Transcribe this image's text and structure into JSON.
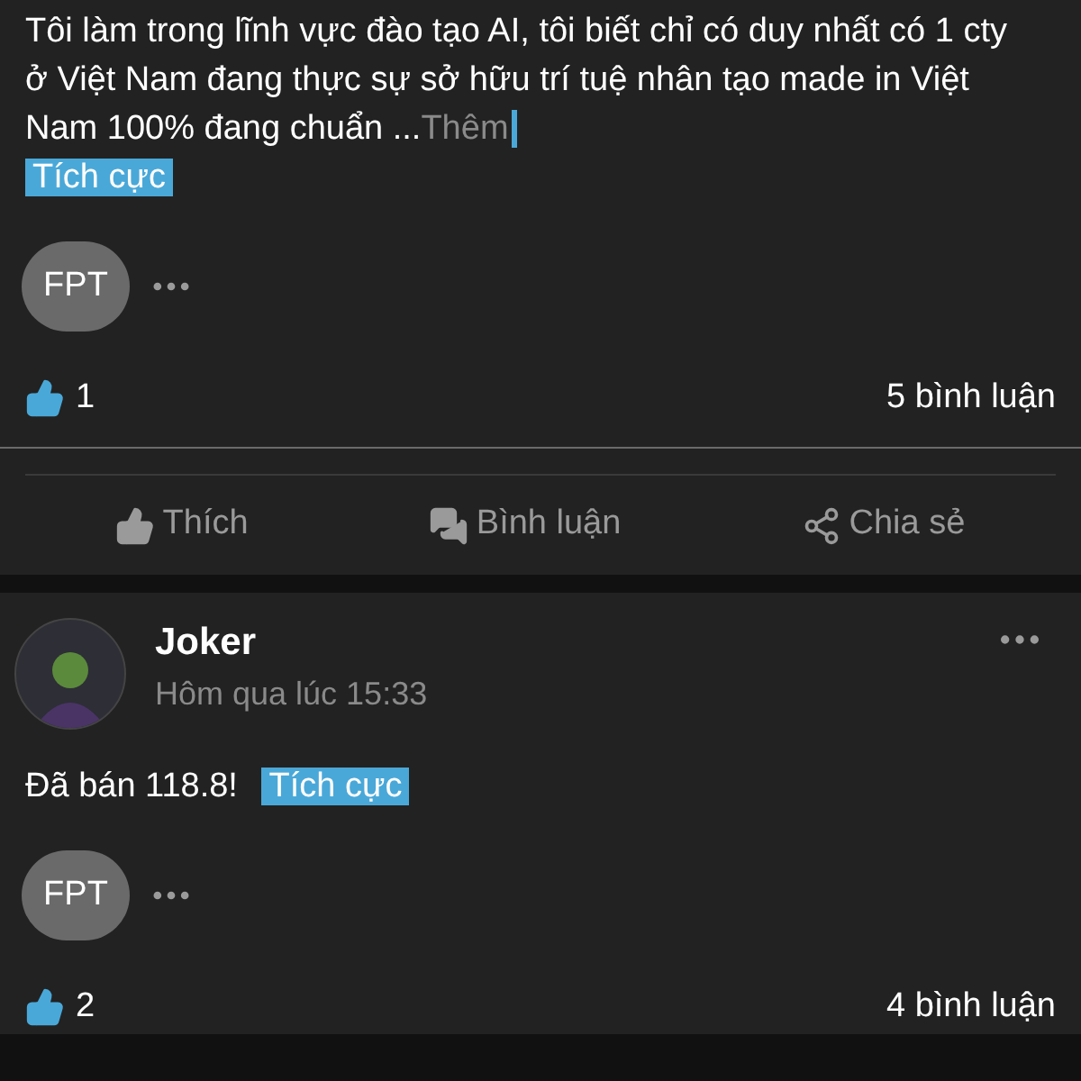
{
  "posts": [
    {
      "body": "Tôi làm trong lĩnh vực đào tạo AI, tôi biết chỉ có duy nhất có 1 cty ở Việt Nam đang thực sự sở hữu trí tuệ nhân tạo made in Việt Nam 100% đang chuẩn ...",
      "more": "Thêm",
      "tag": "Tích cực",
      "stock": "FPT",
      "likes": "1",
      "comments": "5 bình luận",
      "actions": [
        {
          "kind": "like",
          "label": "Thích"
        },
        {
          "kind": "comment",
          "label": "Bình luận"
        },
        {
          "kind": "share",
          "label": "Chia sẻ"
        }
      ]
    },
    {
      "author": "Joker",
      "time": "Hôm qua lúc 15:33",
      "body": "Đã bán 118.8!",
      "tag": "Tích cực",
      "stock": "FPT",
      "likes": "2",
      "comments": "4 bình luận"
    }
  ]
}
